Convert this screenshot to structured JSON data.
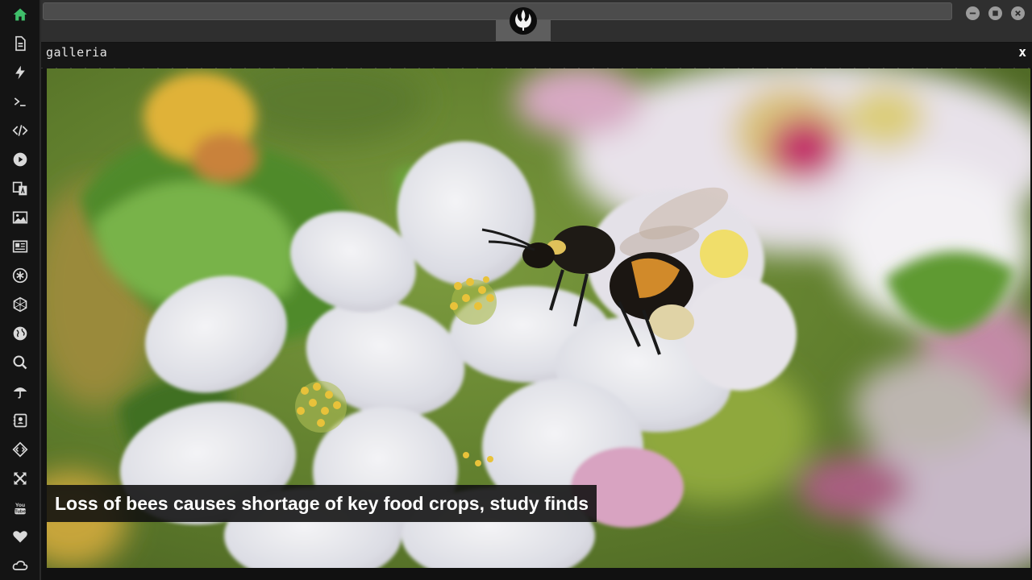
{
  "app": {
    "accent_color": "#3fbf6a",
    "icon_color": "#d9d9d9"
  },
  "sidebar": {
    "items": [
      {
        "icon": "home-icon",
        "active": true
      },
      {
        "icon": "document-icon"
      },
      {
        "icon": "lightning-icon"
      },
      {
        "icon": "terminal-icon"
      },
      {
        "icon": "code-icon"
      },
      {
        "icon": "play-icon"
      },
      {
        "icon": "translate-icon"
      },
      {
        "icon": "image-icon"
      },
      {
        "icon": "news-icon"
      },
      {
        "icon": "asterisk-icon"
      },
      {
        "icon": "hexagon-icon"
      },
      {
        "icon": "globe-icon"
      },
      {
        "icon": "search-icon"
      },
      {
        "icon": "umbrella-icon"
      },
      {
        "icon": "contact-icon"
      },
      {
        "icon": "dev-icon"
      },
      {
        "icon": "expand-icon"
      },
      {
        "icon": "youtube-icon"
      },
      {
        "icon": "heart-icon"
      },
      {
        "icon": "cloud-icon"
      }
    ]
  },
  "topbar": {
    "logo_icon": "rebel-alliance-icon",
    "window_buttons": [
      "minimize-icon",
      "maximize-icon",
      "close-icon"
    ]
  },
  "panel": {
    "title": "galleria",
    "close_label": "x"
  },
  "gallery": {
    "caption": "Loss of bees causes shortage of key food crops, study finds"
  }
}
